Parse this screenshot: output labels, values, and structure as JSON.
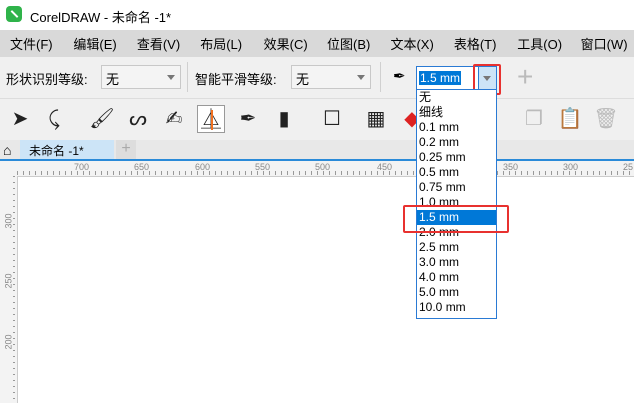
{
  "window": {
    "title": "CorelDRAW - 未命名 -1*"
  },
  "menu": [
    "文件(F)",
    "编辑(E)",
    "查看(V)",
    "布局(L)",
    "效果(C)",
    "位图(B)",
    "文本(X)",
    "表格(T)",
    "工具(O)",
    "窗口(W)"
  ],
  "propbar": {
    "shape_label": "形状识别等级:",
    "shape_value": "无",
    "smooth_label": "智能平滑等级:",
    "smooth_value": "无",
    "width_value": "1.5 mm"
  },
  "tabs": {
    "doc": "未命名 -1*",
    "add": "+"
  },
  "ruler_top": [
    "700",
    "650",
    "600",
    "550",
    "500",
    "450",
    "350",
    "300",
    "25"
  ],
  "ruler_left": [
    "300",
    "250",
    "200"
  ],
  "dropdown": {
    "items": [
      "无",
      "细线",
      "0.1 mm",
      "0.2 mm",
      "0.25 mm",
      "0.5 mm",
      "0.75 mm",
      "1.0 mm",
      "1.5 mm",
      "2.0 mm",
      "2.5 mm",
      "3.0 mm",
      "4.0 mm",
      "5.0 mm",
      "10.0 mm"
    ],
    "selected": "1.5 mm"
  },
  "colors": {
    "accent": "#0078d7",
    "highlight": "#e8312f"
  }
}
